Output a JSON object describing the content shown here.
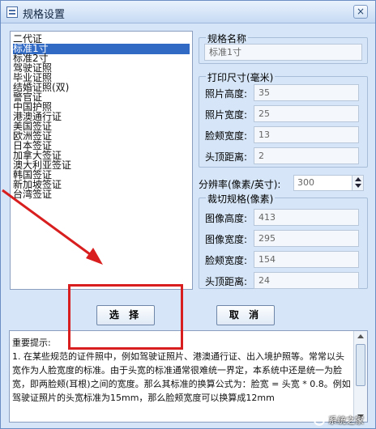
{
  "window": {
    "title": "规格设置",
    "close_symbol": "×"
  },
  "list": {
    "items": [
      "二代证",
      "标准1寸",
      "标准2寸",
      "驾驶证照",
      "毕业证照",
      "结婚证照(双)",
      "警官证",
      "中国护照",
      "港澳通行证",
      "美国签证",
      "欧洲签证",
      "日本签证",
      "加拿大签证",
      "澳大利亚签证",
      "韩国签证",
      "新加坡签证",
      "台湾签证"
    ],
    "selected_index": 1
  },
  "spec_name": {
    "label": "规格名称",
    "value": "标准1寸"
  },
  "print_size": {
    "label": "打印尺寸(毫米)",
    "fields": [
      {
        "label": "照片高度:",
        "value": "35"
      },
      {
        "label": "照片宽度:",
        "value": "25"
      },
      {
        "label": "脸颊宽度:",
        "value": "13"
      },
      {
        "label": "头顶距离:",
        "value": "2"
      }
    ]
  },
  "resolution": {
    "label": "分辨率(像素/英寸):",
    "value": "300"
  },
  "crop_size": {
    "label": "裁切规格(像素)",
    "fields": [
      {
        "label": "图像高度:",
        "value": "413"
      },
      {
        "label": "图像宽度:",
        "value": "295"
      },
      {
        "label": "脸颊宽度:",
        "value": "154"
      },
      {
        "label": "头顶距离:",
        "value": "24"
      }
    ]
  },
  "buttons": {
    "select": "选 择",
    "cancel": "取 消"
  },
  "notes": {
    "text": "重要提示:\n1. 在某些规范的证件照中，例如驾驶证照片、港澳通行证、出入境护照等。常常以头宽作为人脸宽度的标准。由于头宽的标准通常很难统一界定，本系统中还是统一为脸宽，即两脸颊(耳根)之间的宽度。那么其标准的换算公式为：脸宽 = 头宽 * 0.8。例如驾驶证照片的头宽标准为15mm，那么脸颊宽度可以换算成12mm"
  },
  "watermark": "系统之家"
}
